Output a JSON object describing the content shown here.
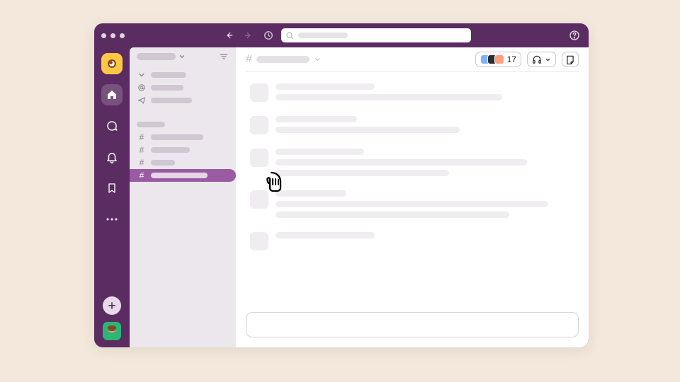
{
  "colors": {
    "brand": "#5b2c62",
    "accent": "#9a5ba3",
    "workspace_icon_bg": "#ffc844"
  },
  "header": {
    "member_count": "17"
  },
  "members_preview": [
    {
      "bg": "#7fb3ff"
    },
    {
      "bg": "#2c2c2c"
    },
    {
      "bg": "#ff9f7f"
    }
  ],
  "sidebar": {
    "sections": [
      {
        "icon": "caret",
        "width": 50
      },
      {
        "icon": "mention",
        "width": 46
      },
      {
        "icon": "send",
        "width": 58
      }
    ],
    "channels": [
      {
        "width": 40,
        "active": false
      },
      {
        "width": 74,
        "active": false
      },
      {
        "width": 55,
        "active": false
      },
      {
        "width": 34,
        "active": false
      },
      {
        "width": 80,
        "active": true
      }
    ]
  },
  "messages": [
    {
      "lines": [
        140,
        320
      ]
    },
    {
      "lines": [
        115,
        260
      ]
    },
    {
      "lines": [
        125,
        355,
        245
      ]
    },
    {
      "lines": [
        100,
        385,
        330
      ]
    },
    {
      "lines": [
        140
      ]
    }
  ]
}
